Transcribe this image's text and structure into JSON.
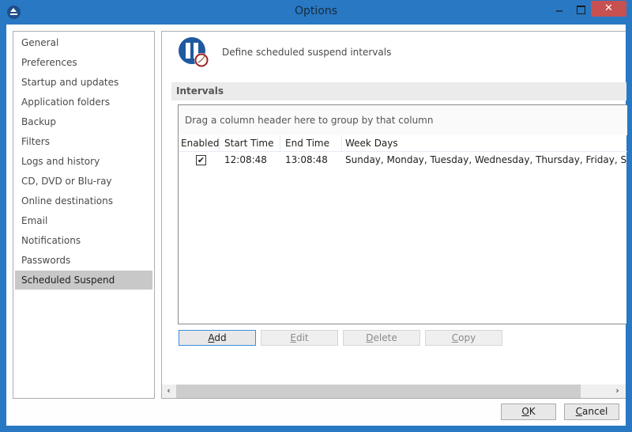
{
  "window": {
    "title": "Options",
    "close_glyph": "✕"
  },
  "sidebar": {
    "items": [
      {
        "label": "General",
        "selected": false
      },
      {
        "label": "Preferences",
        "selected": false
      },
      {
        "label": "Startup and updates",
        "selected": false
      },
      {
        "label": "Application folders",
        "selected": false
      },
      {
        "label": "Backup",
        "selected": false
      },
      {
        "label": "Filters",
        "selected": false
      },
      {
        "label": "Logs and history",
        "selected": false
      },
      {
        "label": "CD, DVD or Blu-ray",
        "selected": false
      },
      {
        "label": "Online destinations",
        "selected": false
      },
      {
        "label": "Email",
        "selected": false
      },
      {
        "label": "Notifications",
        "selected": false
      },
      {
        "label": "Passwords",
        "selected": false
      },
      {
        "label": "Scheduled Suspend",
        "selected": true
      }
    ]
  },
  "main": {
    "header_text": "Define scheduled suspend intervals",
    "header_icon": "pause-clock-icon",
    "section_title": "Intervals",
    "grid": {
      "group_panel_text": "Drag a column header here to group by that column",
      "columns": [
        "Enabled",
        "Start Time",
        "End Time",
        "Week Days"
      ],
      "rows": [
        {
          "enabled": true,
          "check_glyph": "✔",
          "start_time": "12:08:48",
          "end_time": "13:08:48",
          "week_days": "Sunday, Monday, Tuesday, Wednesday, Thursday, Friday, Saturday"
        }
      ]
    },
    "buttons": {
      "add": {
        "accel": "A",
        "rest": "dd",
        "enabled": true
      },
      "edit": {
        "accel": "E",
        "rest": "dit",
        "enabled": false
      },
      "delete": {
        "accel": "D",
        "rest": "elete",
        "enabled": false
      },
      "copy": {
        "accel": "C",
        "rest": "opy",
        "enabled": false
      }
    },
    "scroll": {
      "left_glyph": "‹",
      "right_glyph": "›"
    }
  },
  "dialog": {
    "ok": {
      "accel": "O",
      "rest": "K"
    },
    "cancel": {
      "accel": "C",
      "rest": "ancel"
    }
  }
}
